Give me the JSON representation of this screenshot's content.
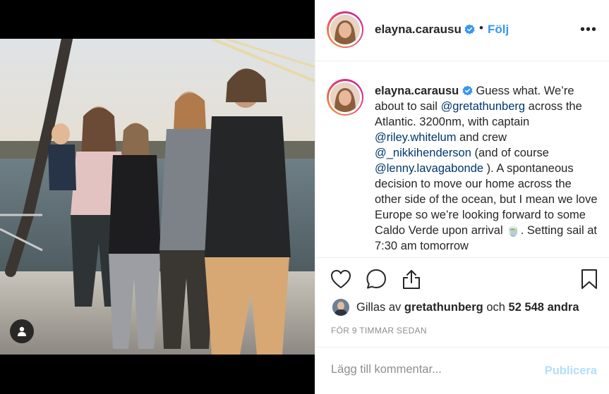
{
  "post": {
    "username": "elayna.carausu",
    "follow_label": "Följ",
    "dot": "•",
    "more": "•••"
  },
  "caption": {
    "username": "elayna.carausu",
    "part1": "Guess what. We’re about to sail ",
    "mention1": "@gretathunberg",
    "part2": " across the Atlantic. 3200nm, with captain ",
    "mention2": "@riley.whitelum",
    "part3": " and crew ",
    "mention3": "@_nikkihenderson",
    "part4": " (and of course ",
    "mention4": "@lenny.lavagabonde",
    "part5": " ). A spontaneous decision to move our home across the other side of the ocean, but I mean we love Europe so we’re looking forward to some Caldo Verde upon arrival 🍵. Setting sail at 7:30 am tomorrow"
  },
  "likes": {
    "prefix": "Gillas av",
    "user": "gretathunberg",
    "conj": "och",
    "count": "52 548 andra"
  },
  "timestamp": "för 9 timmar sedan",
  "comment": {
    "placeholder": "Lägg till kommentar...",
    "publish_label": "Publicera"
  },
  "colors": {
    "accent": "#3897f0",
    "mention": "#00376b",
    "publish_disabled": "#b2dffc",
    "muted": "#8e8e8e"
  },
  "icons": {
    "verified": "verified-badge-icon",
    "like": "heart-icon",
    "comment": "comment-bubble-icon",
    "share": "share-icon",
    "save": "bookmark-icon",
    "tag": "user-tag-icon"
  }
}
